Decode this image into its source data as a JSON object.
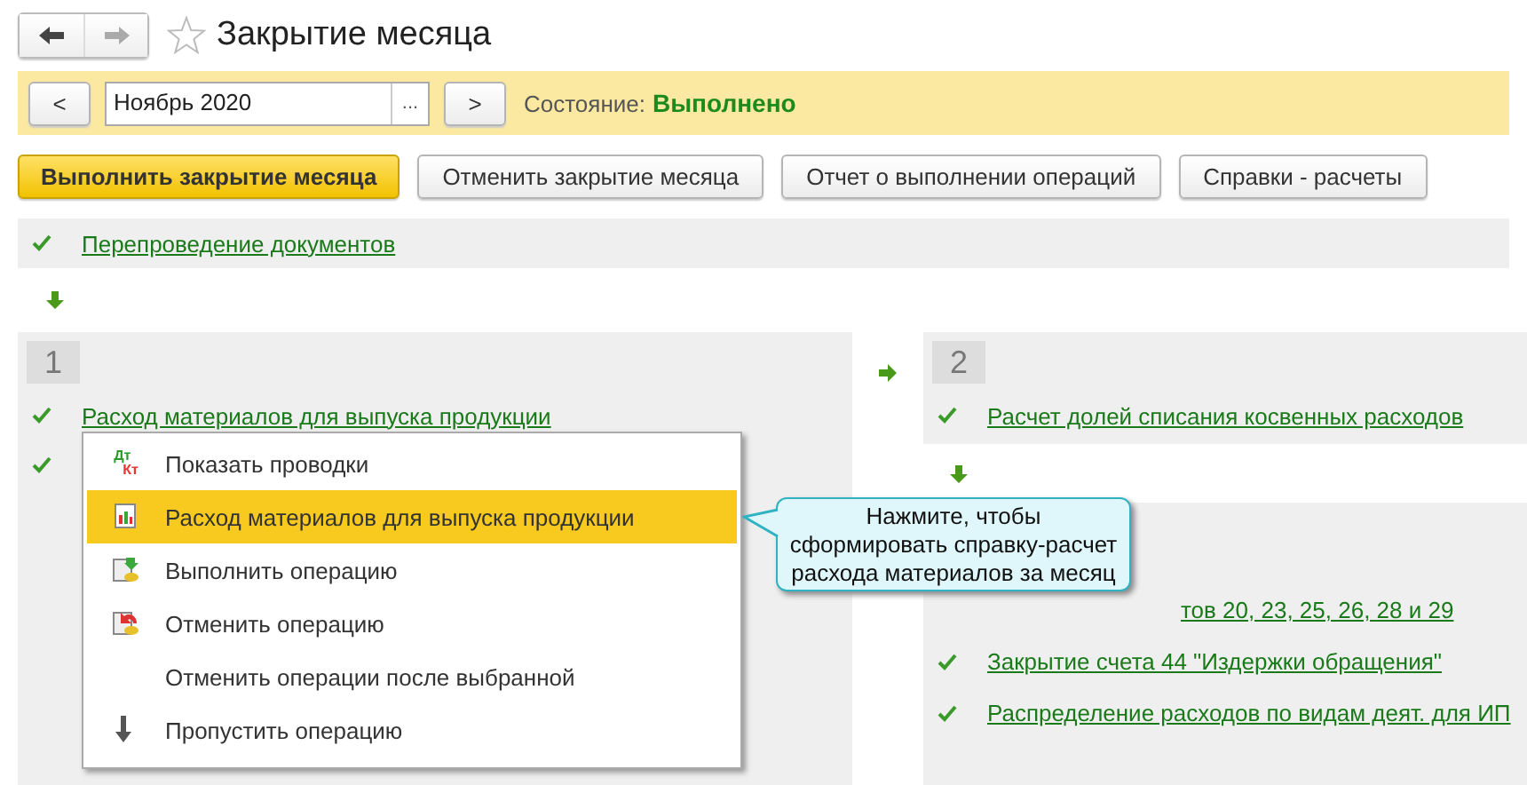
{
  "window": {
    "title": "Закрытие месяца",
    "favorite": false
  },
  "period_bar": {
    "prev": "<",
    "period": "Ноябрь 2020",
    "choose": "...",
    "next": ">",
    "state_label": "Состояние:",
    "state_value": "Выполнено"
  },
  "toolbar": [
    {
      "label": "Выполнить закрытие месяца",
      "kind": "primary"
    },
    {
      "label": "Отменить закрытие месяца",
      "kind": "normal"
    },
    {
      "label": "Отчет о выполнении операций",
      "kind": "normal"
    },
    {
      "label": "Справки - расчеты",
      "kind": "normal"
    }
  ],
  "reposting": {
    "label": "Перепроведение документов",
    "done": true
  },
  "groups": [
    {
      "number": "1",
      "items": [
        {
          "label": "Расход материалов для выпуска продукции",
          "done": true
        },
        {
          "done": true,
          "kind": "covered"
        }
      ]
    },
    {
      "number": "2",
      "items": [
        {
          "label": "Расчет долей списания косвенных расходов",
          "done": true
        }
      ]
    },
    {
      "items": [
        {
          "label": "тов 20, 23, 25, 26, 28 и 29",
          "kind": "partial"
        },
        {
          "label": "Закрытие счета 44 \"Издержки обращения\"",
          "done": true
        },
        {
          "label": "Распределение расходов по видам деят. для ИП",
          "done": true
        }
      ]
    }
  ],
  "context_menu": [
    {
      "label": "Показать проводки",
      "kind": "postings",
      "icon_labels": [
        "Дт",
        "Кт"
      ],
      "selected": false
    },
    {
      "label": "Расход материалов для выпуска продукции",
      "kind": "report",
      "selected": true
    },
    {
      "label": "Выполнить операцию",
      "kind": "run",
      "selected": false
    },
    {
      "label": "Отменить операцию",
      "kind": "undo",
      "selected": false
    },
    {
      "label": "Отменить операции после выбранной",
      "kind": "plain",
      "selected": false
    },
    {
      "label": "Пропустить операцию",
      "kind": "skip",
      "selected": false
    }
  ],
  "tooltip": {
    "text": "Нажмите, чтобы сформировать справку-расчет расхода материалов за месяц"
  }
}
